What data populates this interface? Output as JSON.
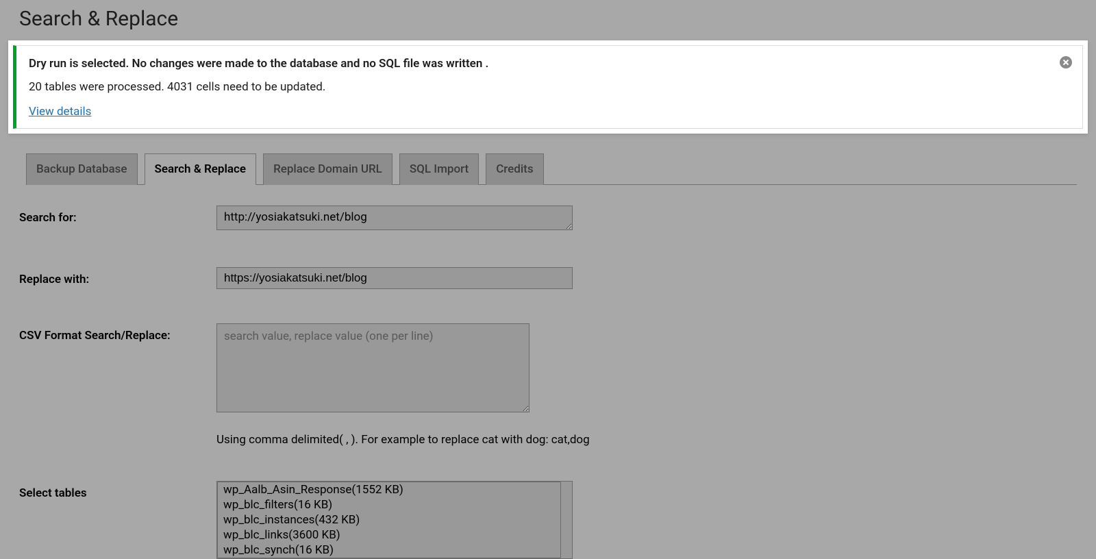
{
  "page_title": "Search & Replace",
  "notice": {
    "title": "Dry run is selected. No changes were made to the database and no SQL file was written .",
    "text": "20 tables were processed. 4031 cells need to be updated.",
    "link": "View details"
  },
  "tabs": [
    {
      "label": "Backup Database",
      "active": false
    },
    {
      "label": "Search & Replace",
      "active": true
    },
    {
      "label": "Replace Domain URL",
      "active": false
    },
    {
      "label": "SQL Import",
      "active": false
    },
    {
      "label": "Credits",
      "active": false
    }
  ],
  "form": {
    "search_for_label": "Search for:",
    "search_for_value": "http://yosiakatsuki.net/blog",
    "replace_with_label": "Replace with:",
    "replace_with_value": "https://yosiakatsuki.net/blog",
    "csv_label": "CSV Format Search/Replace:",
    "csv_placeholder": "search value, replace value (one per line)",
    "csv_help": "Using comma delimited( , ). For example to replace cat with dog: cat,dog",
    "select_tables_label": "Select tables",
    "tables": [
      "wp_Aalb_Asin_Response(1552 KB)",
      "wp_blc_filters(16 KB)",
      "wp_blc_instances(432 KB)",
      "wp_blc_links(3600 KB)",
      "wp_blc_synch(16 KB)"
    ]
  }
}
